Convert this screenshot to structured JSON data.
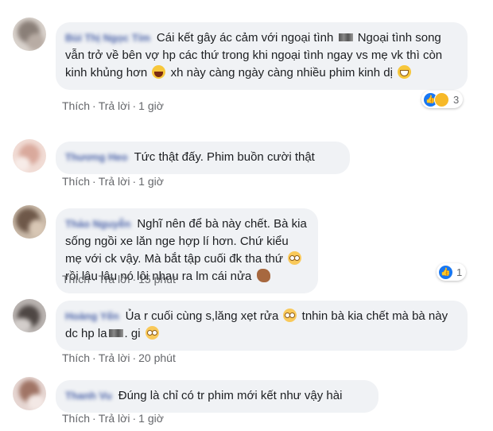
{
  "colors": {
    "link": "#65676b",
    "name": "#4b63a8",
    "bubble": "#f0f2f5",
    "like": "#1877f2"
  },
  "actions": {
    "like": "Thích",
    "reply": "Trả lời",
    "sep": "·"
  },
  "comments": [
    {
      "name": "Bùi Thị Ngọc Tím",
      "text_1": "Cái kết gây ác cảm với ngoại tình",
      "text_2": "Ngoại tình song vẫn trở về bên vợ hp các thứ trong khi ngoại tình ngay vs mẹ vk thì còn kinh khủng hơn",
      "text_3": "xh này càng ngày càng nhiều phim kinh dị",
      "time": "1 giờ",
      "reaction_count": "3"
    },
    {
      "name": "Thương Heo",
      "text": "Tức thật đấy. Phim buồn cười thật",
      "time": "1 giờ"
    },
    {
      "name": "Thảo Nguyễn",
      "text_1": "Nghĩ nên để bà này chết. Bà kia sống ngồi xe lăn nge hợp lí hơn. Chứ kiểu mẹ với ck vậy. Mà bắt tập cuối đk tha thứ",
      "text_2": "rồi lâu lâu nó lôi nhau ra lm cái nửa",
      "time": "15 phút",
      "reaction_count": "1"
    },
    {
      "name": "Hoàng Yến",
      "text_1": "Ủa r cuối cùng s,lăng xẹt rửa",
      "text_2": "tnhin bà kia chết mà bà này dc hp la",
      "text_3": ". gi",
      "time": "20 phút"
    },
    {
      "name": "Thanh Vu",
      "text": "Đúng là chỉ có tr phim mới kết như vậy hài",
      "time": "1 giờ"
    }
  ]
}
